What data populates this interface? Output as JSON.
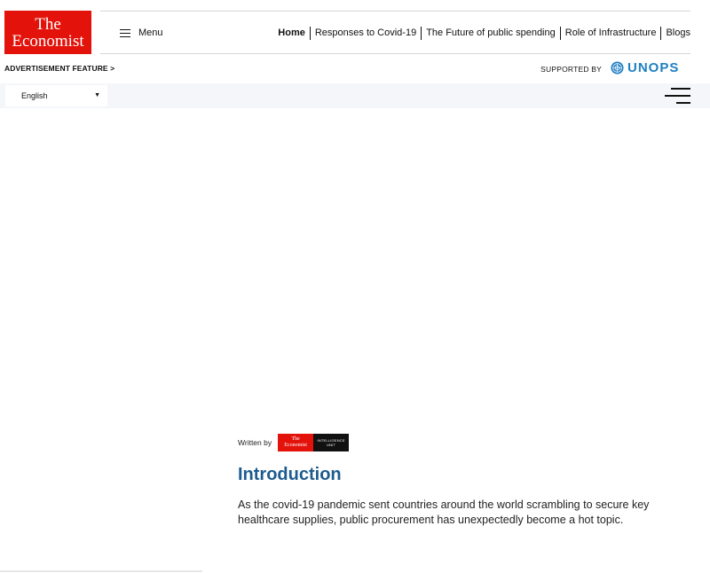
{
  "logo": {
    "line1": "The",
    "line2": "Economist"
  },
  "header": {
    "menu_label": "Menu",
    "nav": [
      "Home",
      "Responses to Covid-19",
      "The Future of public spending",
      "Role of Infrastructure",
      "Blogs"
    ]
  },
  "advert": {
    "feature_label": "ADVERTISEMENT FEATURE >",
    "supported_by": "SUPPORTED BY",
    "sponsor": "UNOPS"
  },
  "language": {
    "selected": "English"
  },
  "byline": {
    "written_by": "Written by",
    "eiu_line1": "The",
    "eiu_line2": "Economist",
    "eiu_unit1": "INTELLIGENCE",
    "eiu_unit2": "UNIT"
  },
  "article": {
    "title": "Introduction",
    "body": "As the covid-19 pandemic sent countries around the world scrambling to secure key healthcare supplies, public procurement has unexpectedly become a hot topic."
  },
  "colors": {
    "brand_red": "#e3120b",
    "title_blue": "#1d5c8e",
    "unops_blue": "#1f7fc2"
  }
}
